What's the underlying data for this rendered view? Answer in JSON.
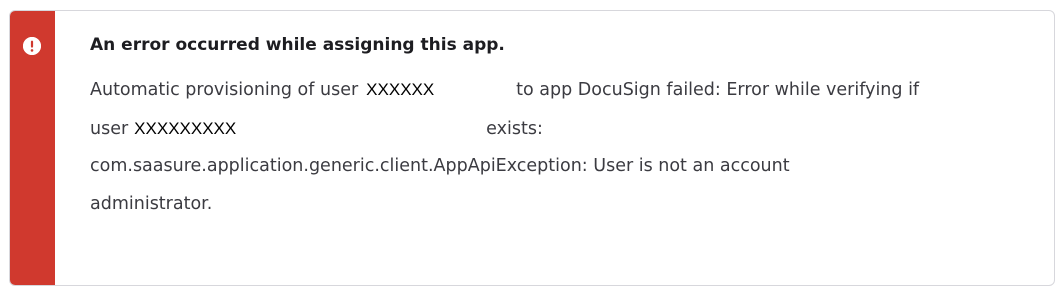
{
  "alert": {
    "severity_color": "#d0392e",
    "icon": "exclamation-circle-icon",
    "title": "An error occurred while assigning this app.",
    "message": {
      "line1_prefix": "Automatic provisioning of user",
      "line1_user": "XXXXXX",
      "line1_suffix": "to app DocuSign failed: Error while verifying if",
      "line2_prefix": "user",
      "line2_user": "XXXXXXXXX",
      "line2_suffix": "exists:",
      "line3": "com.saasure.application.generic.client.AppApiException: User is not an account",
      "line4": "administrator."
    }
  }
}
